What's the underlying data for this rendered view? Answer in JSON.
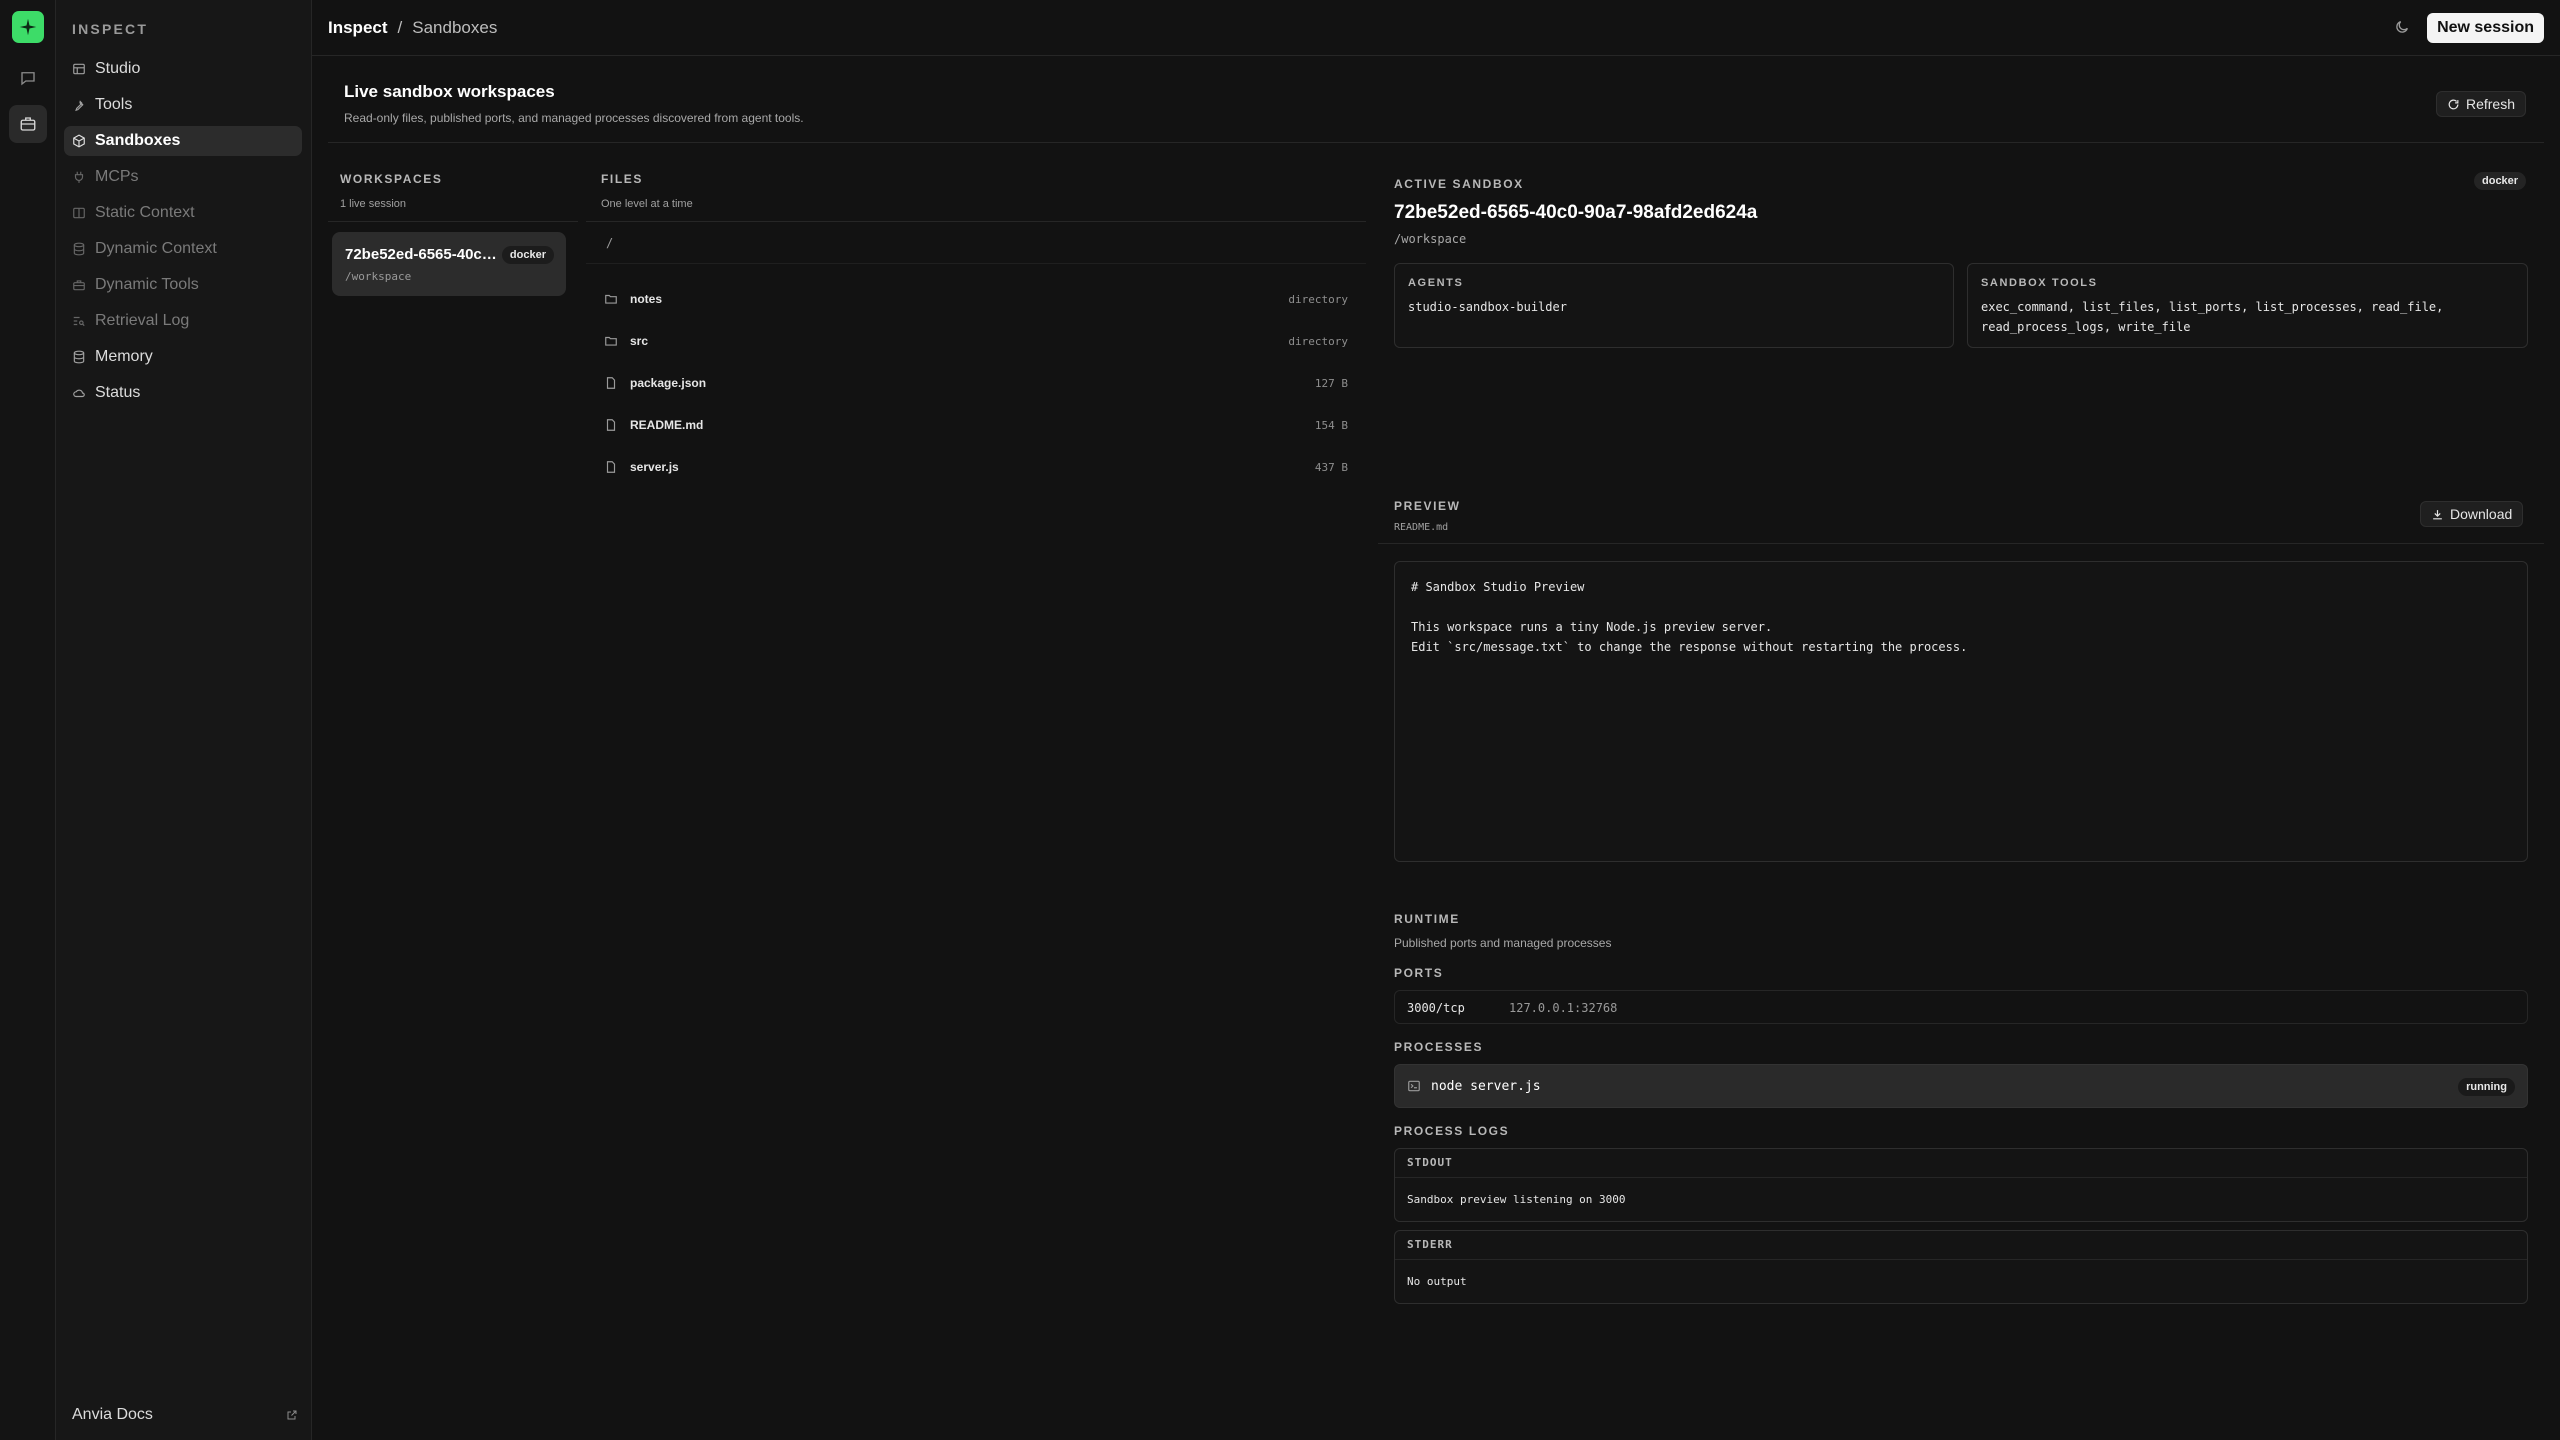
{
  "rail": {
    "items": [
      {
        "icon": "sparkle-logo-icon"
      },
      {
        "icon": "chat-icon"
      },
      {
        "icon": "briefcase-icon"
      }
    ]
  },
  "sidebar": {
    "title": "INSPECT",
    "items": [
      {
        "label": "Studio",
        "icon": "studio-icon"
      },
      {
        "label": "Tools",
        "icon": "wrench-icon"
      },
      {
        "label": "Sandboxes",
        "icon": "cube-icon"
      },
      {
        "label": "MCPs",
        "icon": "plug-icon"
      },
      {
        "label": "Static Context",
        "icon": "book-icon"
      },
      {
        "label": "Dynamic Context",
        "icon": "database-icon"
      },
      {
        "label": "Dynamic Tools",
        "icon": "toolbox-icon"
      },
      {
        "label": "Retrieval Log",
        "icon": "list-search-icon"
      },
      {
        "label": "Memory",
        "icon": "database-icon"
      },
      {
        "label": "Status",
        "icon": "cloud-icon"
      }
    ],
    "footer": "Anvia Docs"
  },
  "topbar": {
    "breadcrumb": [
      "Inspect",
      "/",
      "Sandboxes"
    ],
    "new_session": "New session"
  },
  "header": {
    "title": "Live sandbox workspaces",
    "subtitle": "Read-only files, published ports, and managed processes discovered from agent tools.",
    "refresh": "Refresh"
  },
  "workspaces": {
    "label": "WORKSPACES",
    "sub": "1 live session",
    "card": {
      "name": "72be52ed-6565-40c…",
      "badge": "docker",
      "path": "/workspace"
    }
  },
  "files": {
    "label": "FILES",
    "sub": "One level at a time",
    "root": "/",
    "items": [
      {
        "name": "notes",
        "meta": "directory",
        "type": "folder"
      },
      {
        "name": "src",
        "meta": "directory",
        "type": "folder"
      },
      {
        "name": "package.json",
        "meta": "127 B",
        "type": "file"
      },
      {
        "name": "README.md",
        "meta": "154 B",
        "type": "file"
      },
      {
        "name": "server.js",
        "meta": "437 B",
        "type": "file"
      }
    ]
  },
  "active": {
    "label": "ACTIVE SANDBOX",
    "badge": "docker",
    "id": "72be52ed-6565-40c0-90a7-98afd2ed624a",
    "path": "/workspace",
    "agents_label": "AGENTS",
    "agents_value": "studio-sandbox-builder",
    "tools_label": "SANDBOX TOOLS",
    "tools_value": "exec_command, list_files, list_ports, list_processes, read_file, read_process_logs, write_file"
  },
  "preview": {
    "label": "PREVIEW",
    "file": "README.md",
    "download": "Download",
    "lines": [
      "# Sandbox Studio Preview",
      "This workspace runs a tiny Node.js preview server.",
      "Edit `src/message.txt` to change the response without restarting the process."
    ]
  },
  "runtime": {
    "label": "RUNTIME",
    "sub": "Published ports and managed processes",
    "ports_label": "PORTS",
    "port": {
      "name": "3000/tcp",
      "address": "127.0.0.1:32768"
    },
    "processes_label": "PROCESSES",
    "process": {
      "command": "node server.js",
      "status": "running"
    },
    "logs_label": "PROCESS LOGS",
    "stdout_label": "STDOUT",
    "stdout": "Sandbox preview listening on 3000",
    "stderr_label": "STDERR",
    "stderr": "No output"
  }
}
